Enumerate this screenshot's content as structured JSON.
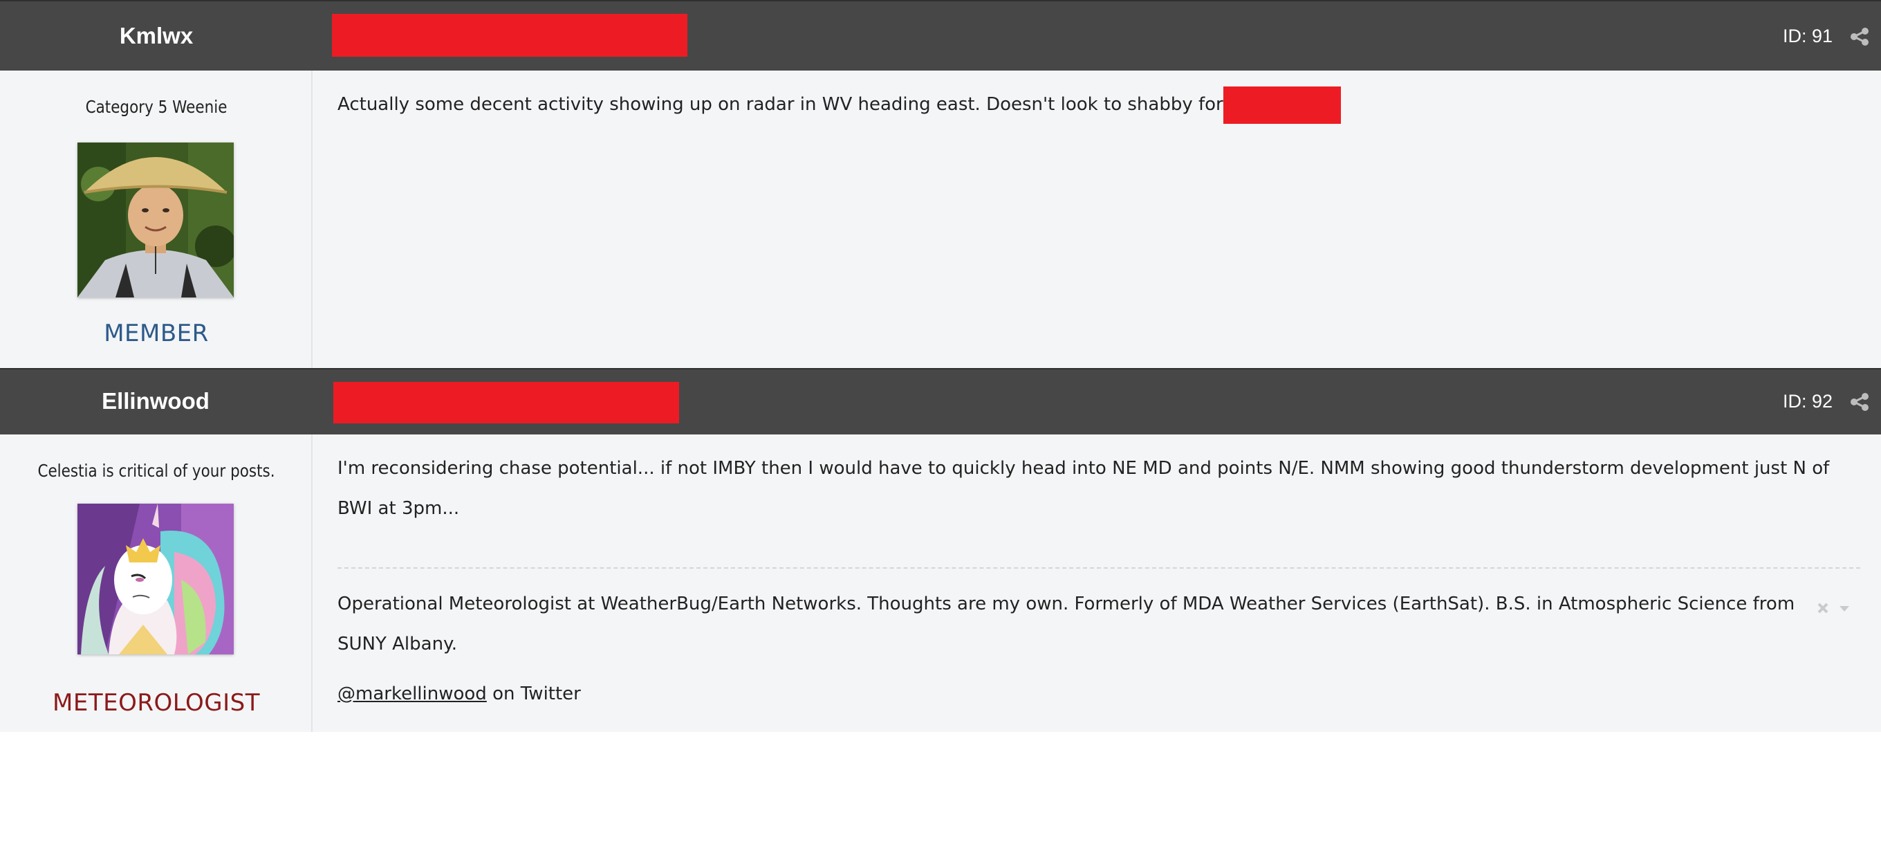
{
  "posts": [
    {
      "author": "Kmlwx",
      "member_title": "Category 5 Weenie",
      "group": "MEMBER",
      "group_color": "#2d5a8a",
      "post_id": "ID: 91",
      "body": "Actually some decent activity showing up on radar in WV heading east. Doesn't look to shabby for"
    },
    {
      "author": "Ellinwood",
      "member_title": "Celestia is critical of your posts.",
      "group": "METEOROLOGIST",
      "group_color": "#8b1a1a",
      "post_id": "ID: 92",
      "body": "I'm reconsidering chase potential... if not IMBY then I would have to quickly head into NE MD and points N/E. NMM showing good thunderstorm development just N of BWI at 3pm...",
      "signature": {
        "text": "Operational Meteorologist at WeatherBug/Earth Networks. Thoughts are my own. Formerly of MDA Weather Services (EarthSat). B.S. in Atmospheric Science from SUNY Albany.",
        "link": "@markellinwood",
        "link_suffix": " on Twitter"
      }
    }
  ],
  "colors": {
    "header_bg": "#474747",
    "body_bg": "#f4f5f7",
    "redaction": "#ed1c24"
  }
}
